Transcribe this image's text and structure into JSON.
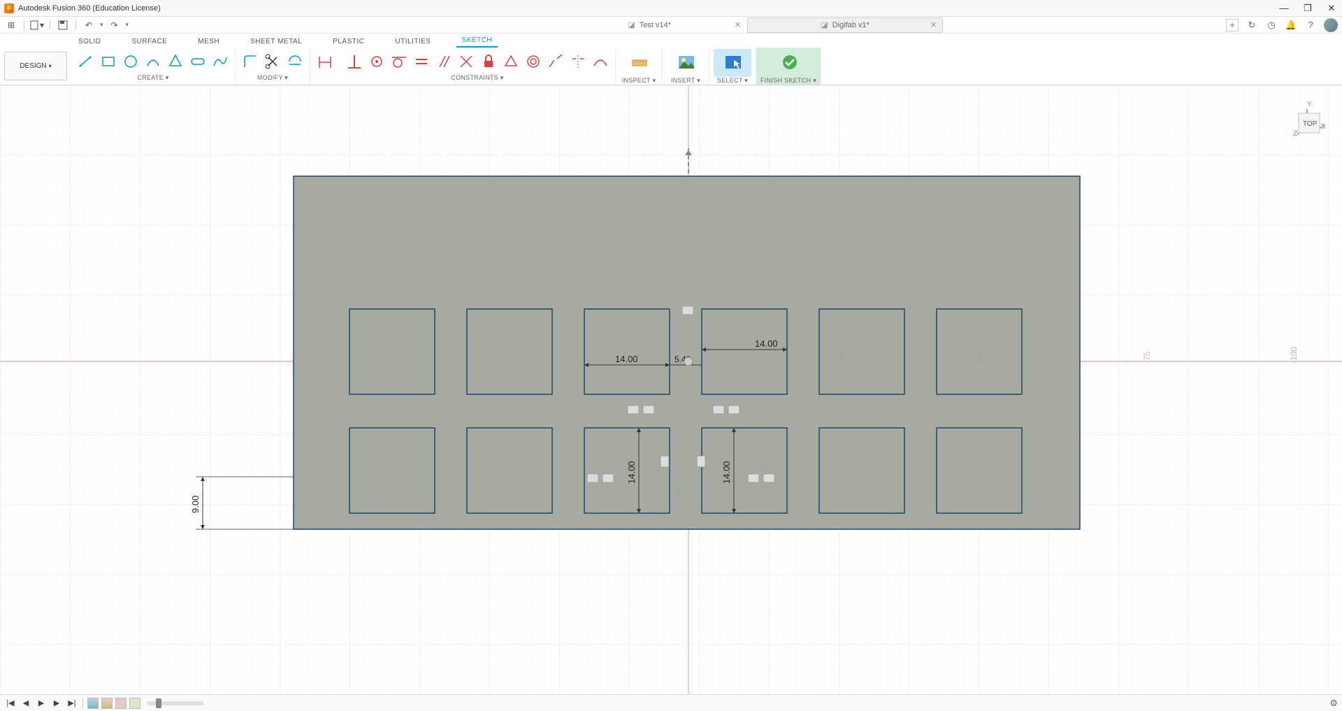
{
  "app": {
    "title": "Autodesk Fusion 360 (Education License)",
    "icon_letter": "F"
  },
  "win_controls": {
    "minimize": "—",
    "maximize": "❐",
    "close": "✕"
  },
  "quick_access": {
    "grid_icon": "⊞",
    "file_icon": "▾",
    "save_icon": "💾",
    "undo_icon": "↶",
    "redo_icon": "↷"
  },
  "doc_tabs": [
    {
      "name": "Test v14*",
      "active": false
    },
    {
      "name": "Digifab v1*",
      "active": true
    }
  ],
  "right_icons": {
    "new": "+",
    "refresh": "↻",
    "clock": "◷",
    "bell": "🔔",
    "help": "?"
  },
  "workspace": {
    "label": "DESIGN"
  },
  "ribbon_tabs": [
    {
      "label": "SOLID",
      "active": false
    },
    {
      "label": "SURFACE",
      "active": false
    },
    {
      "label": "MESH",
      "active": false
    },
    {
      "label": "SHEET METAL",
      "active": false
    },
    {
      "label": "PLASTIC",
      "active": false
    },
    {
      "label": "UTILITIES",
      "active": false
    },
    {
      "label": "SKETCH",
      "active": true
    }
  ],
  "ribbon_groups": {
    "create": {
      "label": "CREATE ▾"
    },
    "modify": {
      "label": "MODIFY ▾"
    },
    "constraints": {
      "label": "CONSTRAINTS ▾"
    },
    "inspect": {
      "label": "INSPECT ▾"
    },
    "insert": {
      "label": "INSERT ▾"
    },
    "select": {
      "label": "SELECT ▾"
    },
    "finish": {
      "label": "FINISH SKETCH ▾"
    }
  },
  "viewcube": {
    "face": "TOP",
    "y": "Y",
    "x": "X",
    "z": "Z"
  },
  "sketch": {
    "dim_14_a": "14.00",
    "dim_14_b": "14.00",
    "dim_540": "5.40",
    "dim_14_v1": "14.00",
    "dim_14_v2": "14.00",
    "dim_9": "9.00",
    "dim_25": "-25",
    "dim_50": "-50",
    "ruler_75": "-75",
    "ruler_100": "-100",
    "ruler_25b": "25"
  },
  "colors": {
    "sketch_fill": "#a4a89c",
    "sketch_line": "#0a3a6a",
    "axis_x": "#e06666",
    "axis_y": "#6aa84f",
    "accent": "#0696d7",
    "lock": "#d94141"
  }
}
